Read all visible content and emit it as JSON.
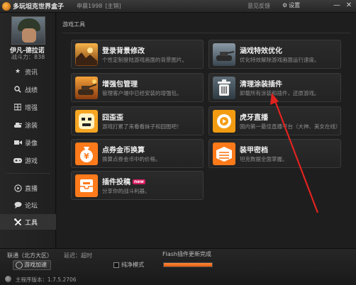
{
  "window": {
    "title": "多玩坦克世界盒子",
    "server": "申晨1998",
    "server_tag": "[主销]",
    "feedback": "意见反馈",
    "settings": "设置",
    "minimize": "—",
    "close": "✕"
  },
  "profile": {
    "name": "伊凡-德拉诺",
    "power": "战斗力：838"
  },
  "sidebar": {
    "items": [
      {
        "label": "资讯",
        "icon": "star-icon"
      },
      {
        "label": "战绩",
        "icon": "search-icon"
      },
      {
        "label": "增强",
        "icon": "grid-icon"
      },
      {
        "label": "涂装",
        "icon": "tank-icon"
      },
      {
        "label": "录像",
        "icon": "video-icon"
      },
      {
        "label": "游戏",
        "icon": "gamepad-icon"
      },
      {
        "label": "直播",
        "icon": "play-icon"
      },
      {
        "label": "论坛",
        "icon": "chat-icon"
      },
      {
        "label": "工具",
        "icon": "tools-icon"
      }
    ]
  },
  "main": {
    "breadcrumb": "游戏工具",
    "cards": [
      {
        "title": "登录背景修改",
        "desc": "个性定制登陆游戏画面的背景图片。",
        "icon": "landscape-icon"
      },
      {
        "title": "涵戏特效优化",
        "desc": "优化特效解除游戏画面运行速度。",
        "icon": "tank-effect-icon"
      },
      {
        "title": "增强包管理",
        "desc": "管理客户端中已经安装的增强包。",
        "icon": "tank-battle-icon"
      },
      {
        "title": "清理涂装插件",
        "desc": "卸载所有涂装和插件，还原游戏。",
        "icon": "trash-icon"
      },
      {
        "title": "囧歪歪",
        "desc": "游戏打累了来看看妹子和囧图吧！",
        "icon": "smiley-icon"
      },
      {
        "title": "虎牙直播",
        "desc": "国内第一最佳直播平台（大神、美女在线）",
        "icon": "huya-icon"
      },
      {
        "title": "点券金币换算",
        "desc": "换算点券金币中的价格。",
        "icon": "money-bag-icon"
      },
      {
        "title": "装甲密档",
        "desc": "坦克数据全面掌握。",
        "icon": "armor-box-icon"
      },
      {
        "title": "插件投稿",
        "desc": "分享你的战斗利器。",
        "badge": "new",
        "icon": "inbox-icon"
      }
    ]
  },
  "status": {
    "network": "联通（北方大区）",
    "latency": "延迟：超时",
    "accelerate": "游戏加速",
    "pure_mode": "纯净模式",
    "flash_update": "Flash插件更新完成",
    "flash_progress": 1.0,
    "version": "主程序版本：1.7.5.2706"
  },
  "colors": {
    "accent": "#ff7a1a",
    "arrow": "#e0231f"
  }
}
